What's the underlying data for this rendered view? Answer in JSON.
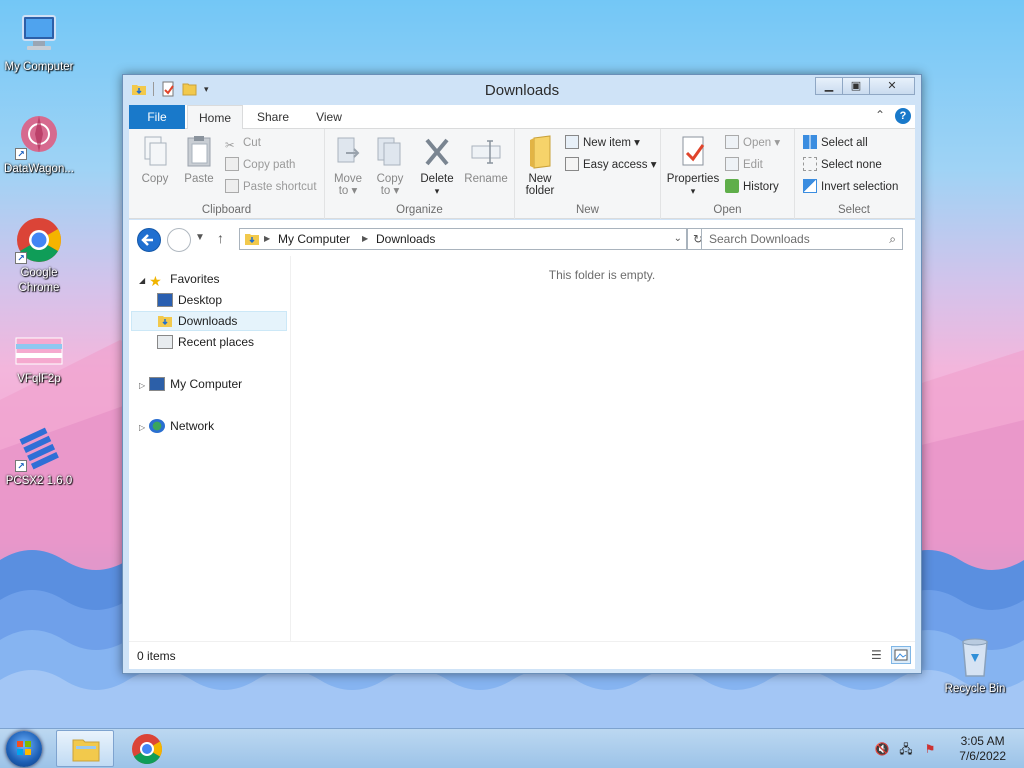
{
  "desktop": {
    "icons": [
      {
        "label": "My Computer"
      },
      {
        "label": "DataWagon..."
      },
      {
        "label": "Google Chrome"
      },
      {
        "label": "VFqlF2p"
      },
      {
        "label": "PCSX2 1.6.0"
      },
      {
        "label": "Recycle Bin"
      }
    ]
  },
  "window": {
    "title": "Downloads",
    "tabs": {
      "file": "File",
      "home": "Home",
      "share": "Share",
      "view": "View"
    },
    "ribbon": {
      "clipboard": {
        "copy": "Copy",
        "paste": "Paste",
        "cut": "Cut",
        "copy_path": "Copy path",
        "paste_shortcut": "Paste shortcut",
        "label": "Clipboard"
      },
      "organize": {
        "move_to": "Move",
        "move_to2": "to",
        "copy_to": "Copy",
        "copy_to2": "to",
        "delete": "Delete",
        "rename": "Rename",
        "label": "Organize"
      },
      "new": {
        "new_folder": "New",
        "new_folder2": "folder",
        "new_item": "New item",
        "easy_access": "Easy access",
        "label": "New"
      },
      "open": {
        "properties": "Properties",
        "open": "Open",
        "edit": "Edit",
        "history": "History",
        "label": "Open"
      },
      "select": {
        "select_all": "Select all",
        "select_none": "Select none",
        "invert_selection": "Invert selection",
        "label": "Select"
      }
    },
    "address": {
      "crumbs": [
        "My Computer",
        "Downloads"
      ]
    },
    "search": {
      "placeholder": "Search Downloads"
    },
    "nav": {
      "favorites": "Favorites",
      "desktop": "Desktop",
      "downloads": "Downloads",
      "recent_places": "Recent places",
      "my_computer": "My Computer",
      "network": "Network"
    },
    "empty_message": "This folder is empty.",
    "status": {
      "items": "0 items"
    }
  },
  "taskbar": {
    "time": "3:05 AM",
    "date": "7/6/2022"
  },
  "colors": {
    "accent": "#1979ca",
    "selection": "#e5f3fb"
  }
}
